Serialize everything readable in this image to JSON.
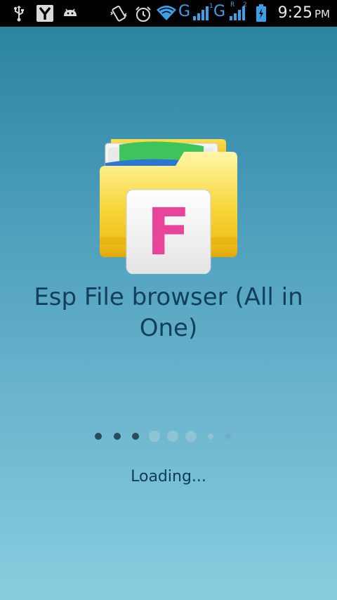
{
  "status_bar": {
    "time": "9:25",
    "ampm": "PM",
    "network_1": "G",
    "network_2": "G",
    "sim_1": "1",
    "sim_2": "2",
    "roaming": "R",
    "icons": [
      "usb-icon",
      "y-app-icon",
      "android-debug-icon",
      "vibrate-icon",
      "alarm-icon",
      "wifi-icon",
      "signal-icon",
      "signal-icon",
      "battery-charging-icon"
    ]
  },
  "splash": {
    "app_icon": "file-folder-f-icon",
    "app_title": "Esp File browser (All in One)",
    "loading_text": "Loading...",
    "dot_colors": {
      "dark": "#2b4a5e",
      "light": "#8fc3d6",
      "faint": "#6aaec8"
    }
  },
  "colors": {
    "background_top": "#2a84a2",
    "background_bottom": "#86cedf",
    "title_text": "#123f5c",
    "folder_yellow": "#f5d23a",
    "letter_pink": "#e8449a"
  }
}
